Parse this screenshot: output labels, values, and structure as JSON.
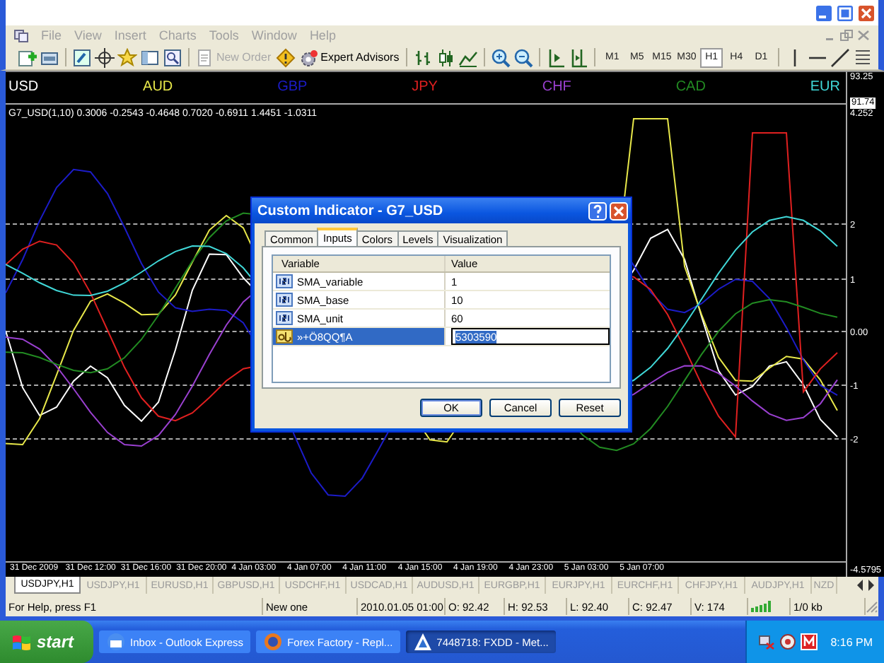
{
  "menu": [
    {
      "label": "File",
      "disabled": true
    },
    {
      "label": "View",
      "disabled": true
    },
    {
      "label": "Insert",
      "disabled": true
    },
    {
      "label": "Charts",
      "disabled": true
    },
    {
      "label": "Tools",
      "disabled": true
    },
    {
      "label": "Window",
      "disabled": true
    },
    {
      "label": "Help",
      "disabled": true
    }
  ],
  "toolbar": {
    "buttons": [
      {
        "label": "New Order",
        "disabled": true
      },
      {
        "label": "Expert Advisors",
        "disabled": false
      }
    ],
    "timeframes": [
      {
        "label": "M1",
        "selected": false
      },
      {
        "label": "M5",
        "selected": false
      },
      {
        "label": "M15",
        "selected": false
      },
      {
        "label": "M30",
        "selected": false
      },
      {
        "label": "H1",
        "selected": true
      },
      {
        "label": "H4",
        "selected": false
      },
      {
        "label": "D1",
        "selected": false
      }
    ]
  },
  "chart": {
    "currencies": [
      {
        "label": "USD",
        "color": "#ffffff"
      },
      {
        "label": "AUD",
        "color": "#e8e84a"
      },
      {
        "label": "GBP",
        "color": "#1c1cc8"
      },
      {
        "label": "JPY",
        "color": "#e02020"
      },
      {
        "label": "CHF",
        "color": "#9a40d0"
      },
      {
        "label": "CAD",
        "color": "#228b22"
      },
      {
        "label": "EUR",
        "color": "#40d8d8"
      }
    ],
    "indicator_label": "G7_USD(1,10) 0.3006 -0.2543 -0.4648 0.7020 -0.6911 1.4451 -1.0311",
    "price_axis": [
      {
        "label": "93.25",
        "current": false
      },
      {
        "label": "91.74",
        "current": true
      }
    ],
    "indicator_axis": [
      "4.252",
      "2",
      "1",
      "0.00",
      "-1",
      "-2",
      "-4.5795"
    ],
    "time_axis": [
      "31 Dec 2009",
      "31 Dec 12:00",
      "31 Dec 16:00",
      "31 Dec 20:00",
      "4 Jan 03:00",
      "4 Jan 07:00",
      "4 Jan 11:00",
      "4 Jan 15:00",
      "4 Jan 19:00",
      "4 Jan 23:00",
      "5 Jan 03:00",
      "5 Jan 07:00"
    ]
  },
  "dialog": {
    "title": "Custom Indicator - G7_USD",
    "tabs": [
      {
        "label": "Common",
        "selected": false
      },
      {
        "label": "Inputs",
        "selected": true
      },
      {
        "label": "Colors",
        "selected": false
      },
      {
        "label": "Levels",
        "selected": false
      },
      {
        "label": "Visualization",
        "selected": false
      }
    ],
    "columns": [
      "Variable",
      "Value"
    ],
    "rows": [
      {
        "kind": "number",
        "variable": "SMA_variable",
        "value": "1",
        "selected": false
      },
      {
        "kind": "number",
        "variable": "SMA_base",
        "value": "10",
        "selected": false
      },
      {
        "kind": "number",
        "variable": "SMA_unit",
        "value": "60",
        "selected": false
      },
      {
        "kind": "text",
        "variable": "»+Ö8QQ¶A",
        "value": "5303590",
        "selected": true
      }
    ],
    "buttons": [
      {
        "label": "OK",
        "default": true
      },
      {
        "label": "Cancel",
        "default": false
      },
      {
        "label": "Reset",
        "default": false
      }
    ]
  },
  "chart_tabs": [
    {
      "label": "USDJPY,H1",
      "selected": true
    },
    {
      "label": "USDJPY,H1",
      "selected": false
    },
    {
      "label": "EURUSD,H1",
      "selected": false
    },
    {
      "label": "GBPUSD,H1",
      "selected": false
    },
    {
      "label": "USDCHF,H1",
      "selected": false
    },
    {
      "label": "USDCAD,H1",
      "selected": false
    },
    {
      "label": "AUDUSD,H1",
      "selected": false
    },
    {
      "label": "EURGBP,H1",
      "selected": false
    },
    {
      "label": "EURJPY,H1",
      "selected": false
    },
    {
      "label": "EURCHF,H1",
      "selected": false
    },
    {
      "label": "CHFJPY,H1",
      "selected": false
    },
    {
      "label": "AUDJPY,H1",
      "selected": false
    },
    {
      "label": "NZD",
      "selected": false
    }
  ],
  "status_bar": [
    "For Help, press F1",
    "New one",
    "2010.01.05 01:00",
    "O: 92.42",
    "H: 92.53",
    "L: 92.40",
    "C: 92.47",
    "V: 174",
    "1/0 kb"
  ],
  "taskbar": {
    "start": "start",
    "tasks": [
      {
        "label": "Inbox - Outlook Express",
        "selected": false
      },
      {
        "label": "Forex Factory - Repl...",
        "selected": false
      },
      {
        "label": "7448718: FXDD - Met...",
        "selected": true
      }
    ],
    "clock": "8:16 PM"
  }
}
